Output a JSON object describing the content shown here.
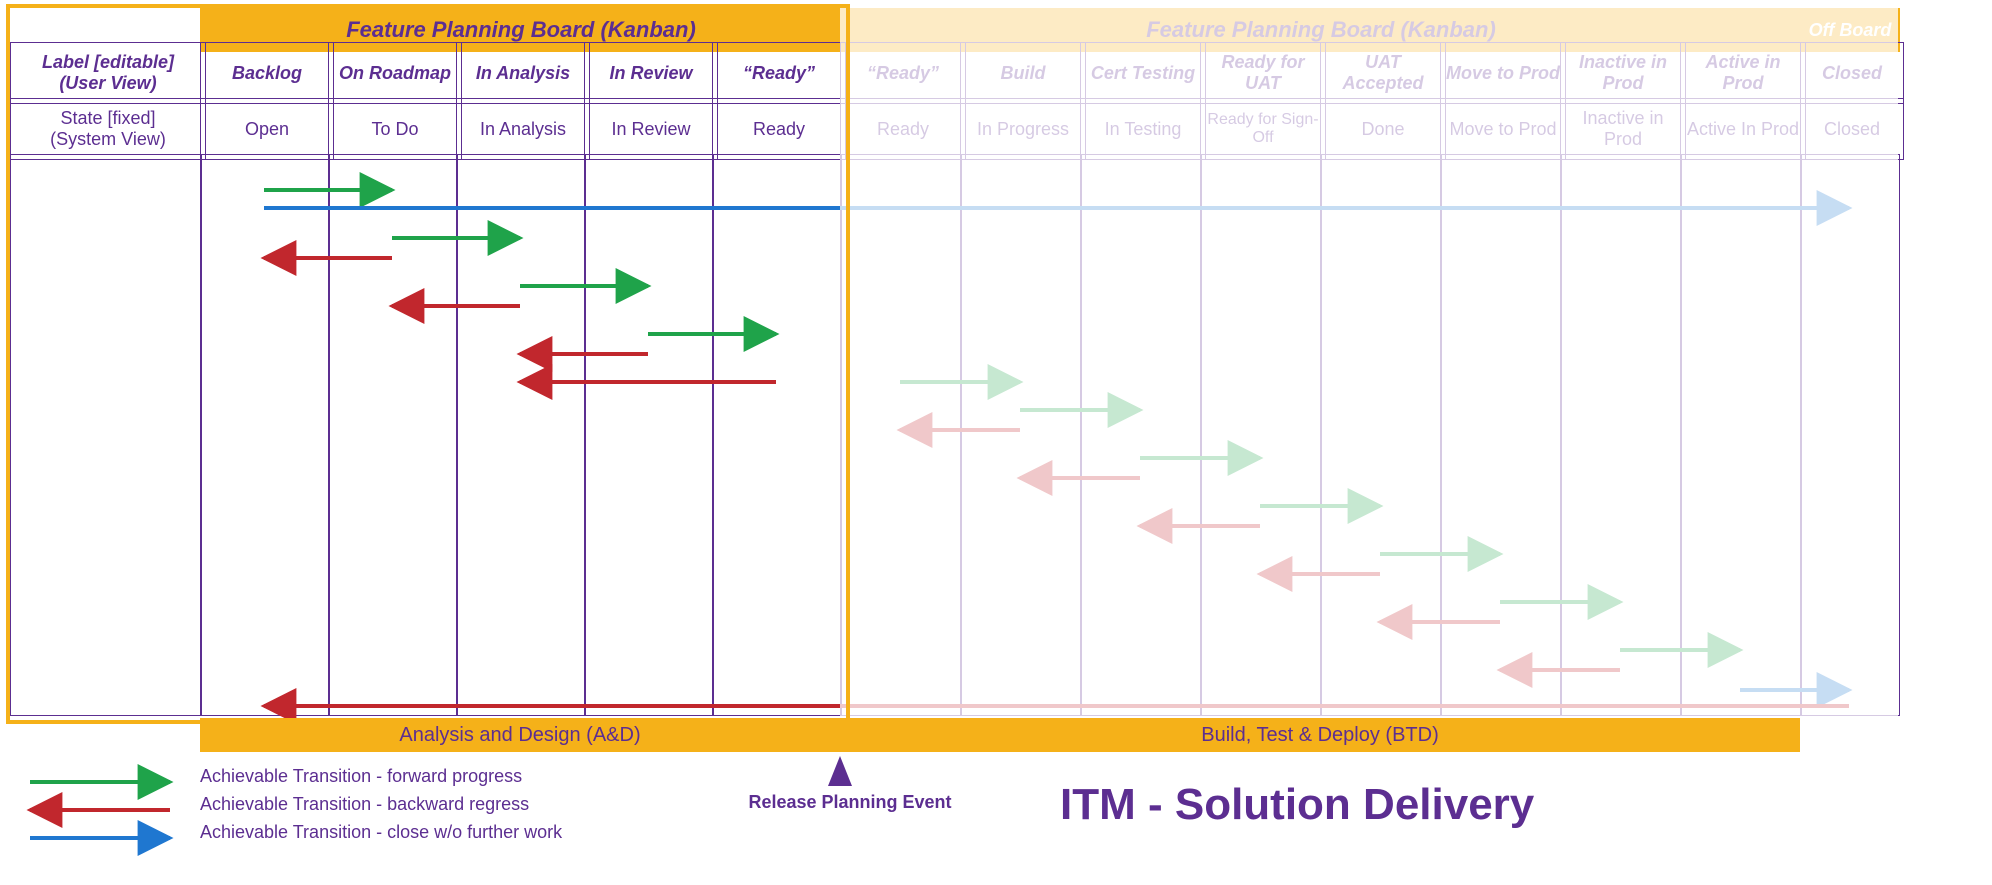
{
  "header": {
    "board_left": "Feature Planning Board (Kanban)",
    "board_right": "Feature Planning Board (Kanban)",
    "off_board": "Off Board"
  },
  "rowLabels": {
    "user": "Label [editable]\n(User View)",
    "system": "State [fixed]\n(System View)"
  },
  "columns": {
    "left": {
      "labels": [
        "Backlog",
        "On Roadmap",
        "In Analysis",
        "In Review",
        "“Ready”"
      ],
      "states": [
        "Open",
        "To Do",
        "In Analysis",
        "In Review",
        "Ready"
      ]
    },
    "right": {
      "labels": [
        "“Ready”",
        "Build",
        "Cert Testing",
        "Ready for UAT",
        "UAT Accepted",
        "Move to Prod",
        "Inactive in Prod",
        "Active in Prod"
      ],
      "states": [
        "Ready",
        "In Progress",
        "In Testing",
        "Ready for Sign-Off",
        "Done",
        "Move to Prod",
        "Inactive in Prod",
        "Active In Prod"
      ]
    },
    "off": {
      "label": "Closed",
      "state": "Closed"
    }
  },
  "footers": {
    "left": "Analysis and Design (A&D)",
    "right": "Build, Test & Deploy (BTD)"
  },
  "legend": {
    "forward": "Achievable Transition - forward progress",
    "backward": "Achievable Transition - backward regress",
    "close": "Achievable Transition - close w/o further work"
  },
  "release_event": "Release Planning Event",
  "title": "ITM - Solution Delivery",
  "colors": {
    "green": "#1FA34A",
    "red": "#C1272D",
    "blue": "#1F77D0",
    "purple": "#5C2E91",
    "orange": "#F5B119"
  },
  "chart_data": {
    "type": "table",
    "title": "Kanban state-transition map for ITM Solution Delivery",
    "states": [
      "Open",
      "To Do",
      "In Analysis",
      "In Review",
      "Ready",
      "In Progress",
      "In Testing",
      "Ready for Sign-Off",
      "Done",
      "Move to Prod",
      "Inactive in Prod",
      "Active In Prod",
      "Closed"
    ],
    "transitions": [
      {
        "from": "Open",
        "to": "To Do",
        "kind": "forward"
      },
      {
        "from": "Open",
        "to": "Closed",
        "kind": "close"
      },
      {
        "from": "To Do",
        "to": "In Analysis",
        "kind": "forward"
      },
      {
        "from": "To Do",
        "to": "Open",
        "kind": "backward"
      },
      {
        "from": "In Analysis",
        "to": "In Review",
        "kind": "forward"
      },
      {
        "from": "In Analysis",
        "to": "To Do",
        "kind": "backward"
      },
      {
        "from": "In Review",
        "to": "Ready",
        "kind": "forward"
      },
      {
        "from": "In Review",
        "to": "In Analysis",
        "kind": "backward"
      },
      {
        "from": "Ready",
        "to": "In Analysis",
        "kind": "backward"
      },
      {
        "from": "Ready",
        "to": "In Progress",
        "kind": "forward"
      },
      {
        "from": "In Progress",
        "to": "Ready",
        "kind": "backward"
      },
      {
        "from": "In Progress",
        "to": "In Testing",
        "kind": "forward"
      },
      {
        "from": "In Testing",
        "to": "In Progress",
        "kind": "backward"
      },
      {
        "from": "In Testing",
        "to": "Ready for Sign-Off",
        "kind": "forward"
      },
      {
        "from": "Ready for Sign-Off",
        "to": "In Testing",
        "kind": "backward"
      },
      {
        "from": "Ready for Sign-Off",
        "to": "Done",
        "kind": "forward"
      },
      {
        "from": "Done",
        "to": "Ready for Sign-Off",
        "kind": "backward"
      },
      {
        "from": "Done",
        "to": "Move to Prod",
        "kind": "forward"
      },
      {
        "from": "Move to Prod",
        "to": "Done",
        "kind": "backward"
      },
      {
        "from": "Move to Prod",
        "to": "Inactive in Prod",
        "kind": "forward"
      },
      {
        "from": "Inactive in Prod",
        "to": "Move to Prod",
        "kind": "backward"
      },
      {
        "from": "Inactive in Prod",
        "to": "Active In Prod",
        "kind": "forward"
      },
      {
        "from": "Active In Prod",
        "to": "Closed",
        "kind": "close"
      },
      {
        "from": "Closed",
        "to": "Open",
        "kind": "backward"
      }
    ],
    "phases": [
      {
        "name": "Analysis and Design (A&D)",
        "covers": [
          "Open",
          "To Do",
          "In Analysis",
          "In Review",
          "Ready"
        ]
      },
      {
        "name": "Build, Test & Deploy (BTD)",
        "covers": [
          "Ready",
          "In Progress",
          "In Testing",
          "Ready for Sign-Off",
          "Done",
          "Move to Prod",
          "Inactive in Prod",
          "Active In Prod"
        ]
      }
    ],
    "milestone": {
      "name": "Release Planning Event",
      "between": [
        "Ready (A&D)",
        "Ready (BTD)"
      ]
    }
  }
}
